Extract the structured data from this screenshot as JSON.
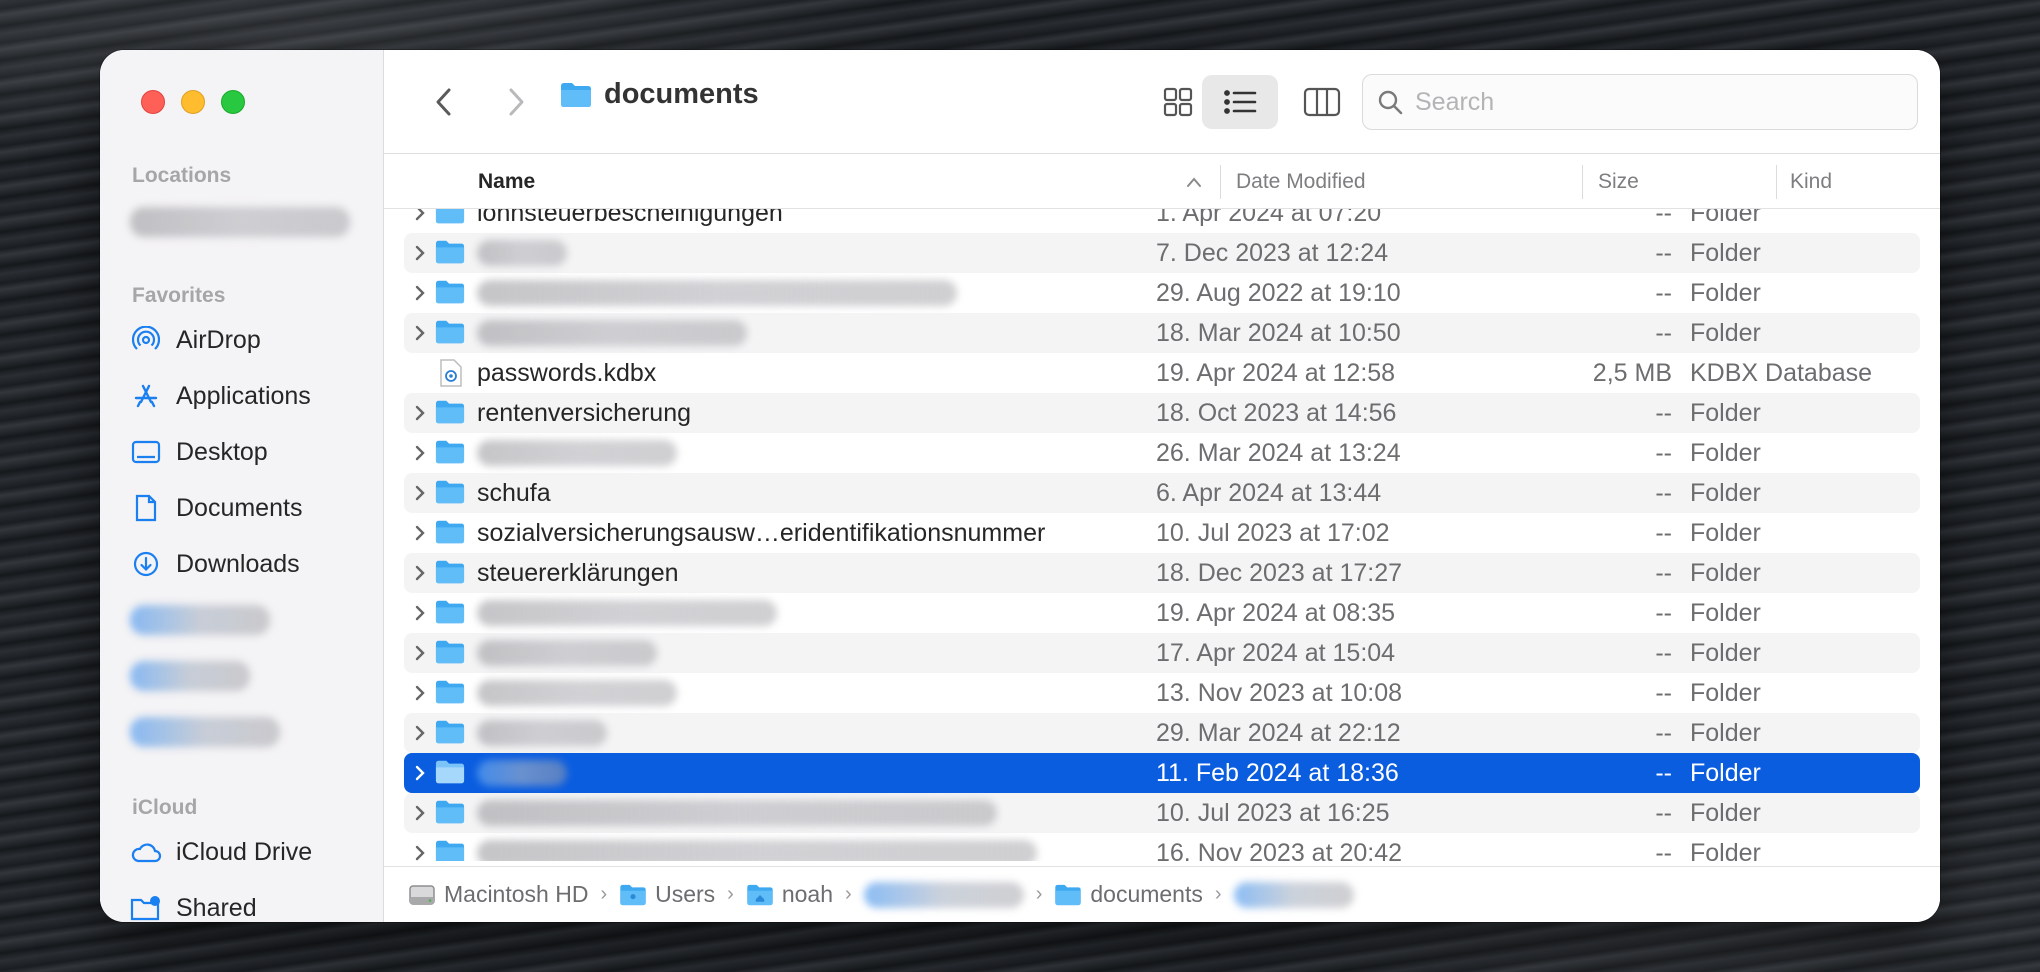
{
  "sidebar": {
    "sections": {
      "locations": "Locations",
      "favorites": "Favorites",
      "icloud": "iCloud"
    },
    "favorites": [
      {
        "label": "AirDrop",
        "icon": "airdrop-icon"
      },
      {
        "label": "Applications",
        "icon": "applications-icon"
      },
      {
        "label": "Desktop",
        "icon": "desktop-icon"
      },
      {
        "label": "Documents",
        "icon": "document-icon"
      },
      {
        "label": "Downloads",
        "icon": "downloads-icon"
      }
    ],
    "icloud": [
      {
        "label": "iCloud Drive",
        "icon": "cloud-icon"
      },
      {
        "label": "Shared",
        "icon": "shared-folder-icon"
      }
    ]
  },
  "toolbar": {
    "title": "documents",
    "search_placeholder": "Search"
  },
  "columns": {
    "name": "Name",
    "date": "Date Modified",
    "size": "Size",
    "kind": "Kind"
  },
  "rows": [
    {
      "name": "lohnsteuerbescheinigungen",
      "date": "1. Apr 2024 at 07:20",
      "size": "--",
      "kind": "Folder"
    },
    {
      "name": "",
      "date": "7. Dec 2023 at 12:24",
      "size": "--",
      "kind": "Folder"
    },
    {
      "name": "",
      "date": "29. Aug 2022 at 19:10",
      "size": "--",
      "kind": "Folder"
    },
    {
      "name": "",
      "date": "18. Mar 2024 at 10:50",
      "size": "--",
      "kind": "Folder"
    },
    {
      "name": "passwords.kdbx",
      "date": "19. Apr 2024 at 12:58",
      "size": "2,5 MB",
      "kind": "KDBX Database"
    },
    {
      "name": "rentenversicherung",
      "date": "18. Oct 2023 at 14:56",
      "size": "--",
      "kind": "Folder"
    },
    {
      "name": "",
      "date": "26. Mar 2024 at 13:24",
      "size": "--",
      "kind": "Folder"
    },
    {
      "name": "schufa",
      "date": "6. Apr 2024 at 13:44",
      "size": "--",
      "kind": "Folder"
    },
    {
      "name": "sozialversicherungsausw…eridentifikationsnummer",
      "date": "10. Jul 2023 at 17:02",
      "size": "--",
      "kind": "Folder"
    },
    {
      "name": "steuererklärungen",
      "date": "18. Dec 2023 at 17:27",
      "size": "--",
      "kind": "Folder"
    },
    {
      "name": "",
      "date": "19. Apr 2024 at 08:35",
      "size": "--",
      "kind": "Folder"
    },
    {
      "name": "",
      "date": "17. Apr 2024 at 15:04",
      "size": "--",
      "kind": "Folder"
    },
    {
      "name": "",
      "date": "13. Nov 2023 at 10:08",
      "size": "--",
      "kind": "Folder"
    },
    {
      "name": "",
      "date": "29. Mar 2024 at 22:12",
      "size": "--",
      "kind": "Folder"
    },
    {
      "name": "",
      "date": "11. Feb 2024 at 18:36",
      "size": "--",
      "kind": "Folder"
    },
    {
      "name": "",
      "date": "10. Jul 2023 at 16:25",
      "size": "--",
      "kind": "Folder"
    },
    {
      "name": "",
      "date": "16. Nov 2023 at 20:42",
      "size": "--",
      "kind": "Folder"
    }
  ],
  "pathbar": {
    "items": [
      "Macintosh HD",
      "Users",
      "noah",
      "",
      "documents",
      ""
    ]
  }
}
